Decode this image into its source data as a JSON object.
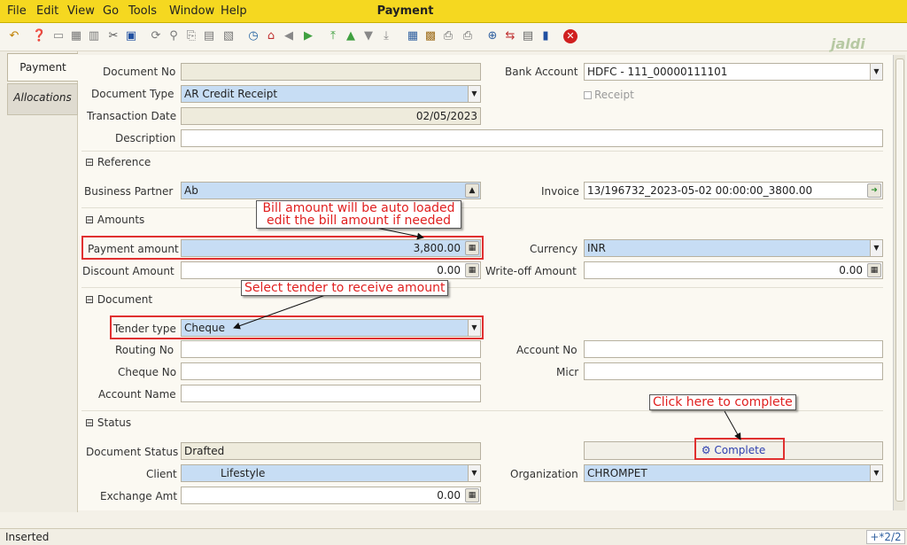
{
  "menubar": {
    "items": [
      "File",
      "Edit",
      "View",
      "Go",
      "Tools",
      "Window",
      "Help"
    ],
    "title": "Payment"
  },
  "brand": "jaldi",
  "tabs": [
    {
      "label": "Payment",
      "active": true
    },
    {
      "label": "Allocations",
      "active": false
    }
  ],
  "form": {
    "document_no": {
      "label": "Document No",
      "value": ""
    },
    "document_type": {
      "label": "Document Type",
      "value": "AR Credit Receipt"
    },
    "transaction_date": {
      "label": "Transaction Date",
      "value": "02/05/2023"
    },
    "description": {
      "label": "Description",
      "value": ""
    },
    "bank_account": {
      "label": "Bank Account",
      "value": "HDFC - 111_00000111101"
    },
    "receipt": {
      "label": "Receipt",
      "checked": false
    },
    "reference_section": "Reference",
    "business_partner": {
      "label": "Business Partner",
      "value": "Ab"
    },
    "invoice": {
      "label": "Invoice",
      "value": "13/196732_2023-05-02 00:00:00_3800.00"
    },
    "amounts_section": "Amounts",
    "payment_amount": {
      "label": "Payment amount",
      "value": "3,800.00"
    },
    "currency": {
      "label": "Currency",
      "value": "INR"
    },
    "discount_amount": {
      "label": "Discount Amount",
      "value": "0.00"
    },
    "writeoff_amount": {
      "label": "Write-off Amount",
      "value": "0.00"
    },
    "document_section": "Document",
    "tender_type": {
      "label": "Tender type",
      "value": "Cheque"
    },
    "routing_no": {
      "label": "Routing No",
      "value": ""
    },
    "account_no": {
      "label": "Account No",
      "value": ""
    },
    "cheque_no": {
      "label": "Cheque No",
      "value": ""
    },
    "micr": {
      "label": "Micr",
      "value": ""
    },
    "account_name": {
      "label": "Account Name",
      "value": ""
    },
    "status_section": "Status",
    "document_status": {
      "label": "Document Status",
      "value": "Drafted"
    },
    "complete_button": "Complete",
    "client": {
      "label": "Client",
      "value": "Lifestyle"
    },
    "organization": {
      "label": "Organization",
      "value": "CHROMPET"
    },
    "exchange_amt": {
      "label": "Exchange Amt",
      "value": "0.00"
    }
  },
  "annotations": {
    "bill_amount_line1": "Bill amount will be auto loaded",
    "bill_amount_line2": "edit the bill amount if needed",
    "tender": "Select tender to receive amount",
    "complete": "Click here to complete"
  },
  "statusbar": {
    "left": "Inserted",
    "right": "+*2/2"
  },
  "colors": {
    "menubar": "#f5d820",
    "field_blue": "#c7ddf4",
    "annotation_red": "#e02020"
  }
}
